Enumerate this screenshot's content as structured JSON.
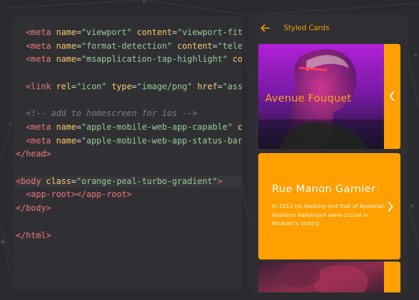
{
  "editor": {
    "lines": [
      {
        "indent": "  ",
        "tokens": [
          [
            "tag",
            "<meta"
          ],
          [
            "pun",
            " "
          ],
          [
            "attr",
            "name"
          ],
          [
            "pun",
            "="
          ],
          [
            "str",
            "\"viewport\""
          ],
          [
            "pun",
            " "
          ],
          [
            "attr",
            "content"
          ],
          [
            "pun",
            "="
          ],
          [
            "str",
            "\"viewport-fit="
          ]
        ]
      },
      {
        "indent": "  ",
        "tokens": [
          [
            "tag",
            "<meta"
          ],
          [
            "pun",
            " "
          ],
          [
            "attr",
            "name"
          ],
          [
            "pun",
            "="
          ],
          [
            "str",
            "\"format-detection\""
          ],
          [
            "pun",
            " "
          ],
          [
            "attr",
            "content"
          ],
          [
            "pun",
            "="
          ],
          [
            "str",
            "\"telep"
          ]
        ]
      },
      {
        "indent": "  ",
        "tokens": [
          [
            "tag",
            "<meta"
          ],
          [
            "pun",
            " "
          ],
          [
            "attr",
            "name"
          ],
          [
            "pun",
            "="
          ],
          [
            "str",
            "\"msapplication-tap-highlight\""
          ],
          [
            "pun",
            " "
          ],
          [
            "attr",
            "cor"
          ]
        ]
      },
      {
        "indent": "",
        "tokens": []
      },
      {
        "indent": "  ",
        "tokens": [
          [
            "tag",
            "<link"
          ],
          [
            "pun",
            " "
          ],
          [
            "attr",
            "rel"
          ],
          [
            "pun",
            "="
          ],
          [
            "str",
            "\"icon\""
          ],
          [
            "pun",
            " "
          ],
          [
            "attr",
            "type"
          ],
          [
            "pun",
            "="
          ],
          [
            "str",
            "\"image/png\""
          ],
          [
            "pun",
            " "
          ],
          [
            "attr",
            "href"
          ],
          [
            "pun",
            "="
          ],
          [
            "str",
            "\"asse"
          ]
        ]
      },
      {
        "indent": "",
        "tokens": []
      },
      {
        "indent": "  ",
        "tokens": [
          [
            "com",
            "<!-- add to homescreen for ios -->"
          ]
        ]
      },
      {
        "indent": "  ",
        "tokens": [
          [
            "tag",
            "<meta"
          ],
          [
            "pun",
            " "
          ],
          [
            "attr",
            "name"
          ],
          [
            "pun",
            "="
          ],
          [
            "str",
            "\"apple-mobile-web-app-capable\""
          ],
          [
            "pun",
            " "
          ],
          [
            "attr",
            "co"
          ]
        ]
      },
      {
        "indent": "  ",
        "tokens": [
          [
            "tag",
            "<meta"
          ],
          [
            "pun",
            " "
          ],
          [
            "attr",
            "name"
          ],
          [
            "pun",
            "="
          ],
          [
            "str",
            "\"apple-mobile-web-app-status-bar-"
          ]
        ]
      },
      {
        "indent": "",
        "tokens": [
          [
            "tag",
            "</head>"
          ]
        ]
      },
      {
        "indent": "",
        "tokens": []
      },
      {
        "indent": "",
        "tokens": [
          [
            "tag",
            "<body"
          ],
          [
            "pun",
            " "
          ],
          [
            "attr",
            "class"
          ],
          [
            "pun",
            "="
          ],
          [
            "str",
            "\"orange-peal-turbo-gradient\""
          ],
          [
            "tag",
            ">"
          ]
        ]
      },
      {
        "indent": "  ",
        "tokens": [
          [
            "tag",
            "<app-root></app-root>"
          ]
        ]
      },
      {
        "indent": "",
        "tokens": [
          [
            "tag",
            "</body>"
          ]
        ]
      },
      {
        "indent": "",
        "tokens": []
      },
      {
        "indent": "",
        "tokens": [
          [
            "tag",
            "</html>"
          ]
        ]
      }
    ]
  },
  "phone": {
    "appbar_title": "Styled Cards",
    "back_icon": "arrow-left-icon",
    "cards": [
      {
        "title": "Avenue Fouquet",
        "chevron": "chevron-left-icon"
      },
      {
        "title": "Rue Manon Garnier",
        "text": "In 2013 his backing and that of Ayatollah Hashemi Rafsanjani were crucial in Rouhani's victory.",
        "chevron": "chevron-right-icon"
      },
      {
        "title": ""
      }
    ]
  },
  "colors": {
    "accent": "#ff9f00",
    "background": "#2b2b2f",
    "panel": "#303034"
  }
}
